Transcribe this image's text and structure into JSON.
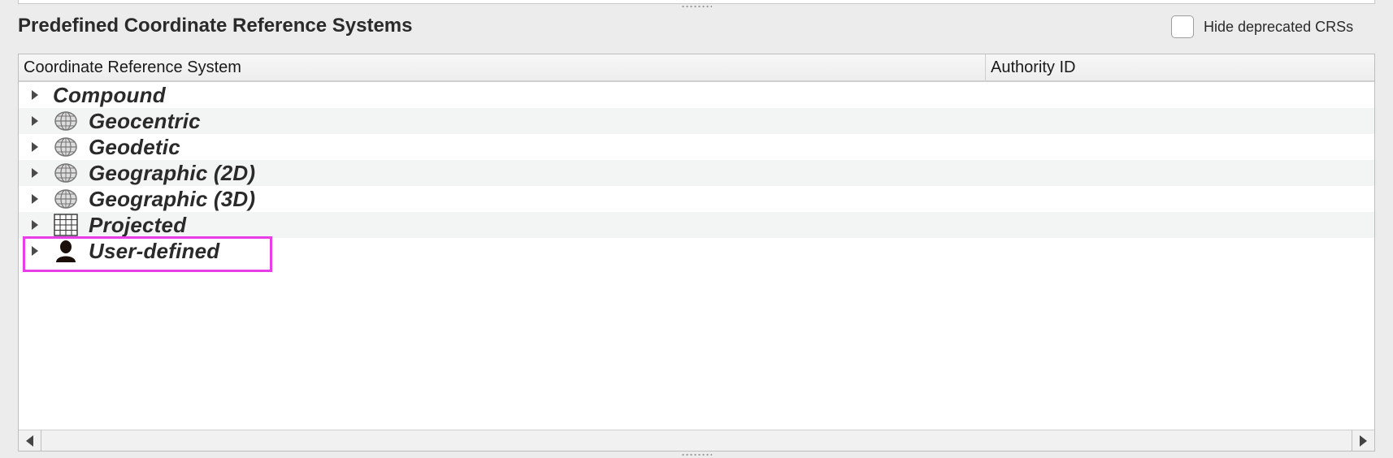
{
  "section_title": "Predefined Coordinate Reference Systems",
  "hide_deprecated": {
    "label": "Hide deprecated CRSs",
    "checked": false
  },
  "table": {
    "columns": [
      "Coordinate Reference System",
      "Authority ID"
    ]
  },
  "tree": {
    "items": [
      {
        "label": "Compound",
        "icon": "none"
      },
      {
        "label": "Geocentric",
        "icon": "globe-icon"
      },
      {
        "label": "Geodetic",
        "icon": "globe-icon"
      },
      {
        "label": "Geographic (2D)",
        "icon": "globe-icon"
      },
      {
        "label": "Geographic (3D)",
        "icon": "globe-icon"
      },
      {
        "label": "Projected",
        "icon": "grid-icon"
      },
      {
        "label": "User-defined",
        "icon": "user-icon",
        "highlighted": true
      }
    ]
  },
  "colors": {
    "highlight": "#e83ee8",
    "row_alt": "#f3f4f4"
  }
}
